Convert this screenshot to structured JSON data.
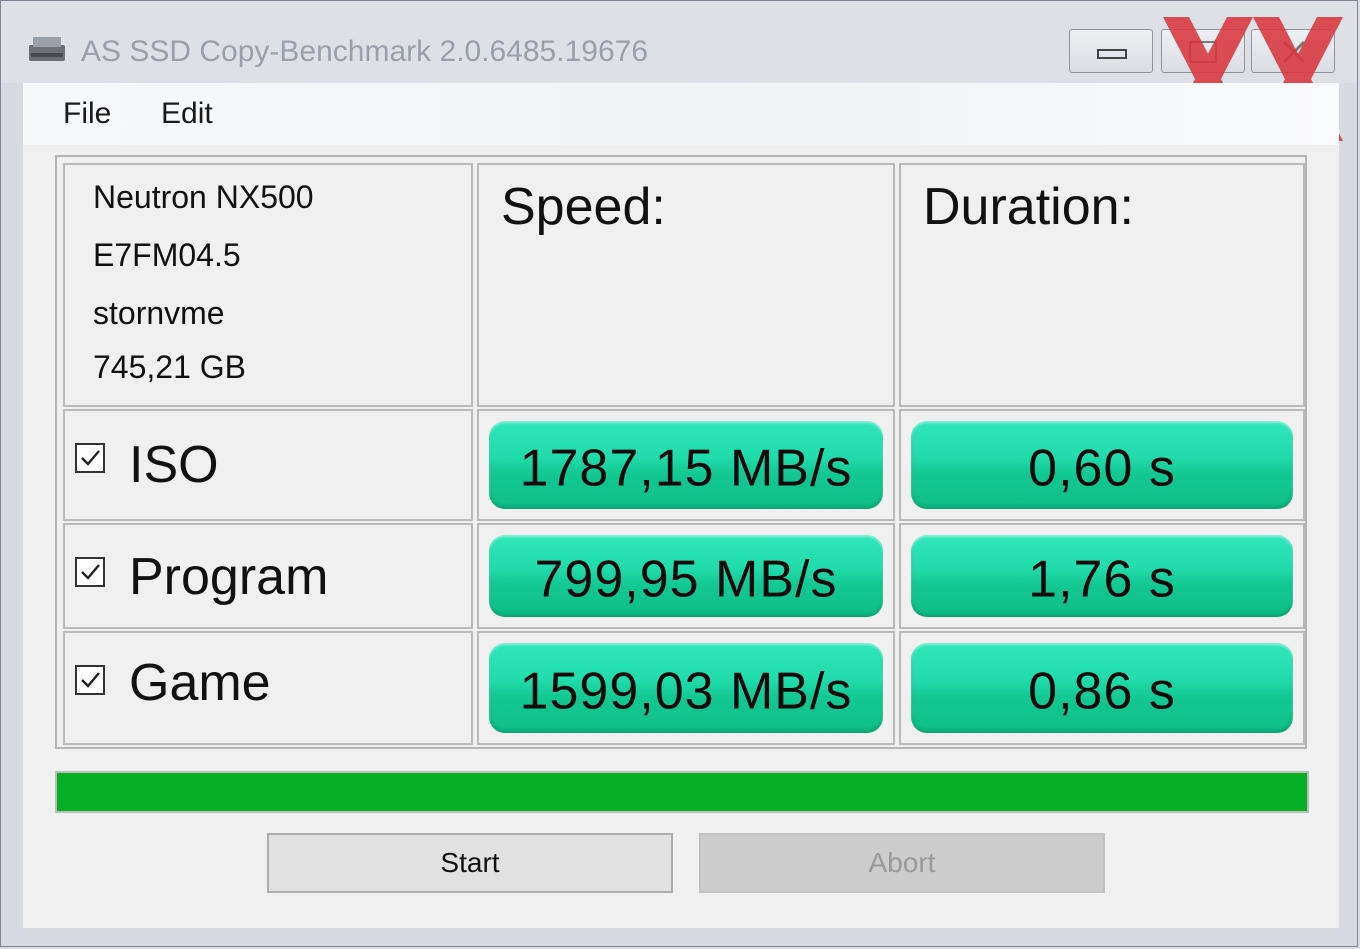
{
  "window": {
    "title": "AS SSD Copy-Benchmark 2.0.6485.19676"
  },
  "menu": {
    "items": [
      "File",
      "Edit"
    ]
  },
  "drive": {
    "model": "Neutron NX500",
    "firmware": "E7FM04.5",
    "driver": "stornvme",
    "capacity": "745,21 GB"
  },
  "headers": {
    "speed": "Speed:",
    "duration": "Duration:"
  },
  "rows": [
    {
      "name": "ISO",
      "checked": true,
      "speed": "1787,15 MB/s",
      "duration": "0,60 s"
    },
    {
      "name": "Program",
      "checked": true,
      "speed": "799,95 MB/s",
      "duration": "1,76 s"
    },
    {
      "name": "Game",
      "checked": true,
      "speed": "1599,03 MB/s",
      "duration": "0,86 s"
    }
  ],
  "progress": {
    "fraction": 1.0,
    "color": "#06b025"
  },
  "buttons": {
    "start": "Start",
    "abort": "Abort",
    "abort_enabled": false
  },
  "colors": {
    "result_bar": "#1fd9a8",
    "watermark": "#d9363e"
  },
  "icons": [
    "drive-icon",
    "minimize-icon",
    "maximize-icon",
    "close-icon",
    "checkbox-checked-icon"
  ]
}
